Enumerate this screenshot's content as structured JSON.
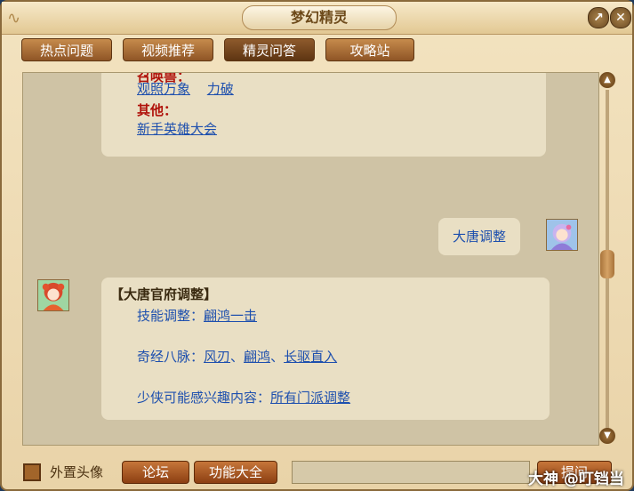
{
  "window": {
    "title": "梦幻精灵"
  },
  "tabs": [
    {
      "label": "热点问题"
    },
    {
      "label": "视频推荐"
    },
    {
      "label": "精灵问答"
    },
    {
      "label": "攻略站"
    }
  ],
  "chat": {
    "first_bubble": {
      "partial_header": "召唤兽：",
      "line1_links": [
        "观照万象",
        "力破"
      ],
      "other_label": "其他：",
      "other_link": "新手英雄大会"
    },
    "user_message": "大唐调整",
    "reply": {
      "title": "【大唐官府调整】",
      "skill_label": "技能调整：",
      "skill_link": "翩鸿一击",
      "qijing_label": "奇经八脉：",
      "qijing_links": [
        "风刃",
        "翩鸿",
        "长驱直入"
      ],
      "separator": "、",
      "interest_label": "少侠可能感兴趣内容：",
      "interest_link": "所有门派调整"
    }
  },
  "bottom": {
    "checkbox_label": "外置头像",
    "forum_button": "论坛",
    "features_button": "功能大全",
    "ask_button": "提问"
  },
  "watermark": "大神 @叮铛当"
}
